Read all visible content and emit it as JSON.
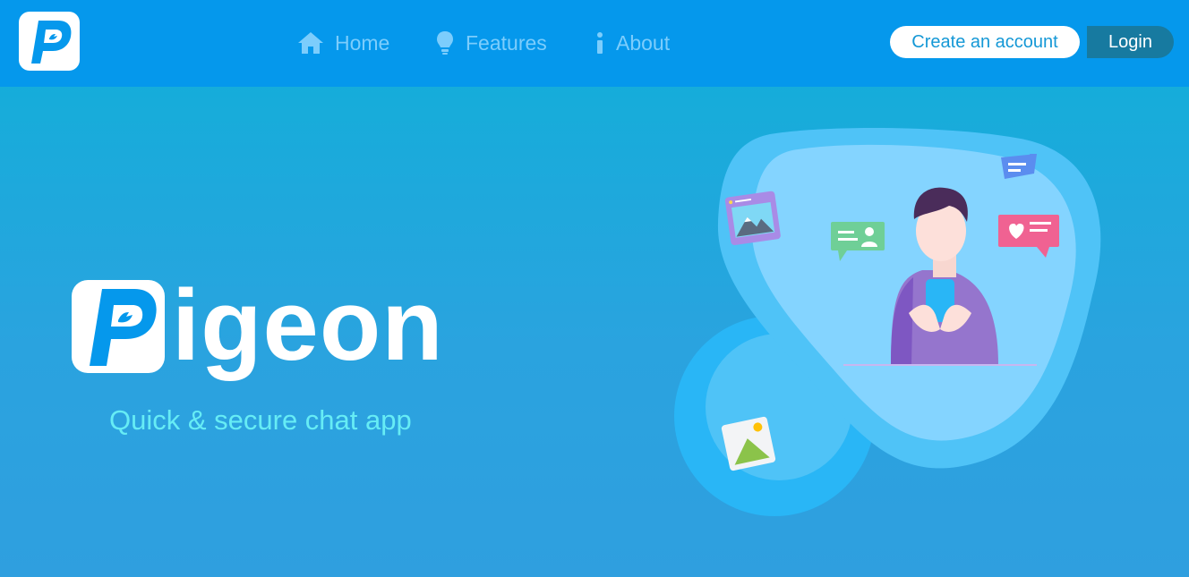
{
  "header": {
    "logo_icon": "pigeon-p-logo-icon",
    "nav": [
      {
        "label": "Home",
        "icon": "home-icon"
      },
      {
        "label": "Features",
        "icon": "lightbulb-icon"
      },
      {
        "label": "About",
        "icon": "info-icon"
      }
    ],
    "create_account_label": "Create an account",
    "login_label": "Login"
  },
  "hero": {
    "brand_logo_icon": "pigeon-p-logo-icon",
    "brand_name": "igeon",
    "tagline": "Quick & secure chat app",
    "illustration": "person-with-phone-chat-illustration"
  },
  "colors": {
    "navbar": "#0598ec",
    "nav_text": "#7ccdfc",
    "login_button": "#177aa0",
    "tagline": "#66ecf5",
    "hero_gradient_top": "#0fb0d8",
    "hero_gradient_bottom": "#2f9fdf"
  }
}
